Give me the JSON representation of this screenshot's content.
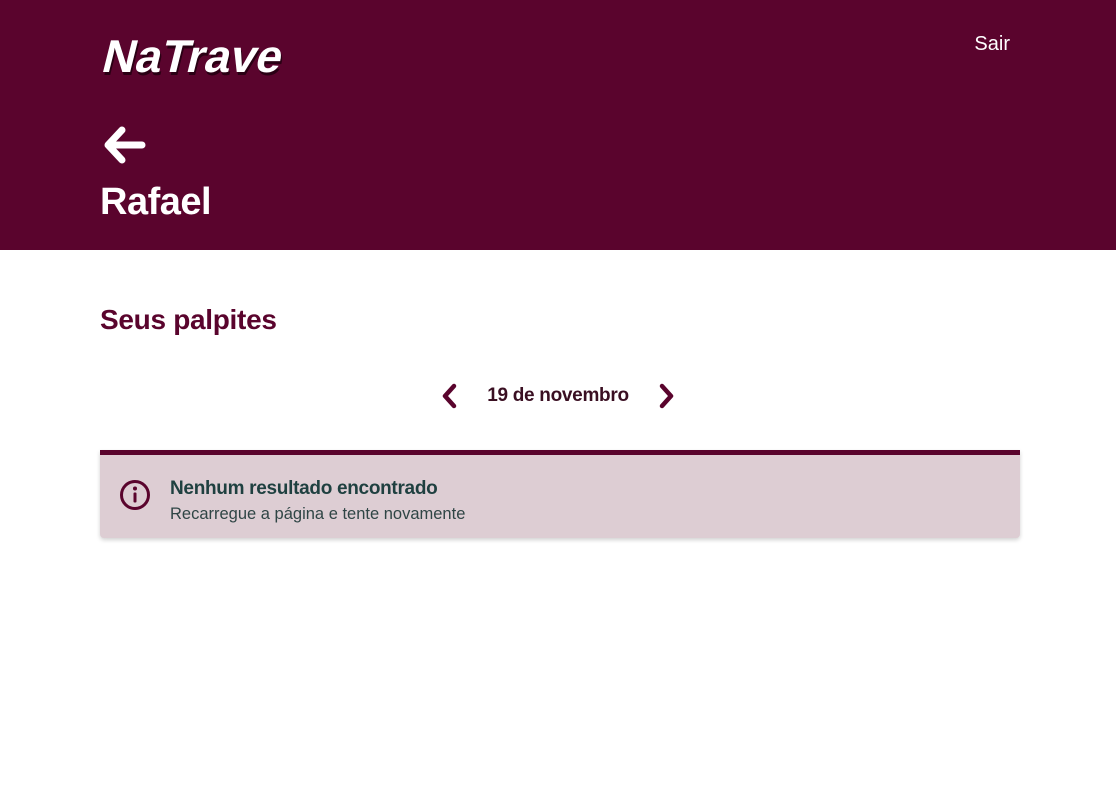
{
  "app": {
    "logo_text": "NaTrave",
    "brand_color": "#5a042d"
  },
  "header": {
    "logout_label": "Sair",
    "back_icon": "arrow-left-icon",
    "user_name": "Rafael"
  },
  "main": {
    "section_title": "Seus palpites",
    "date_nav": {
      "prev_icon": "chevron-left-icon",
      "date_label": "19 de novembro",
      "next_icon": "chevron-right-icon"
    },
    "alert": {
      "icon": "info-icon",
      "title": "Nenhum resultado encontrado",
      "message": "Recarregue a página e tente novamente"
    }
  }
}
